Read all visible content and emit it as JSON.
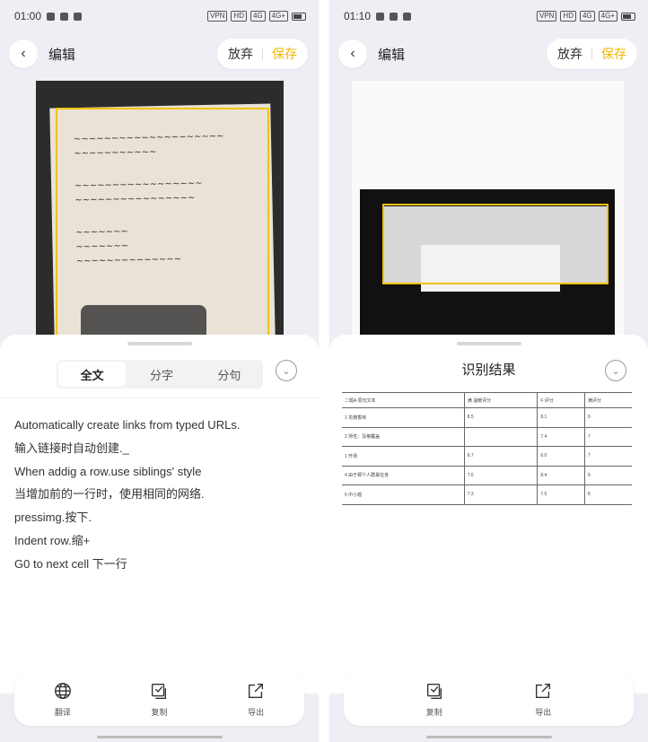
{
  "left": {
    "status": {
      "time": "01:00"
    },
    "header": {
      "title": "编辑",
      "discard": "放弃",
      "save": "保存"
    },
    "tabs": [
      "全文",
      "分字",
      "分句"
    ],
    "ocr_lines": [
      "Automatically create links from typed URLs.",
      "输入链接时自动创建._",
      "When addig a row.use siblings' style",
      "当增加前的一行时，使用相同的网络.",
      "pressimg.按下.",
      "Indent row.缩+",
      "G0 to next cell 下一行"
    ],
    "toolbar": {
      "translate": "翻译",
      "copy": "复制",
      "export": "导出"
    }
  },
  "right": {
    "status": {
      "time": "01:10"
    },
    "header": {
      "title": "编辑",
      "discard": "放弃",
      "save": "保存"
    },
    "sheet_title": "识别结果",
    "table_rows": [
      [
        "二题A 原句文本",
        "满 温暖评分",
        "F 评分",
        "满评分"
      ],
      [
        "1 花瓣香味",
        "8.5",
        "8.1",
        "9"
      ],
      [
        "2 持性：及格覆盖",
        "",
        "7.4",
        "7"
      ],
      [
        "1 开场",
        "6.7",
        "6.0",
        "7"
      ],
      [
        "4 由于那个人群最在身",
        "7.6",
        "8.4",
        "9"
      ],
      [
        "5 中小题",
        "7.3",
        "7.0",
        "8"
      ]
    ],
    "toolbar": {
      "copy": "复制",
      "export": "导出"
    }
  },
  "colors": {
    "accent": "#f0b400",
    "crop": "#f4c20d"
  }
}
